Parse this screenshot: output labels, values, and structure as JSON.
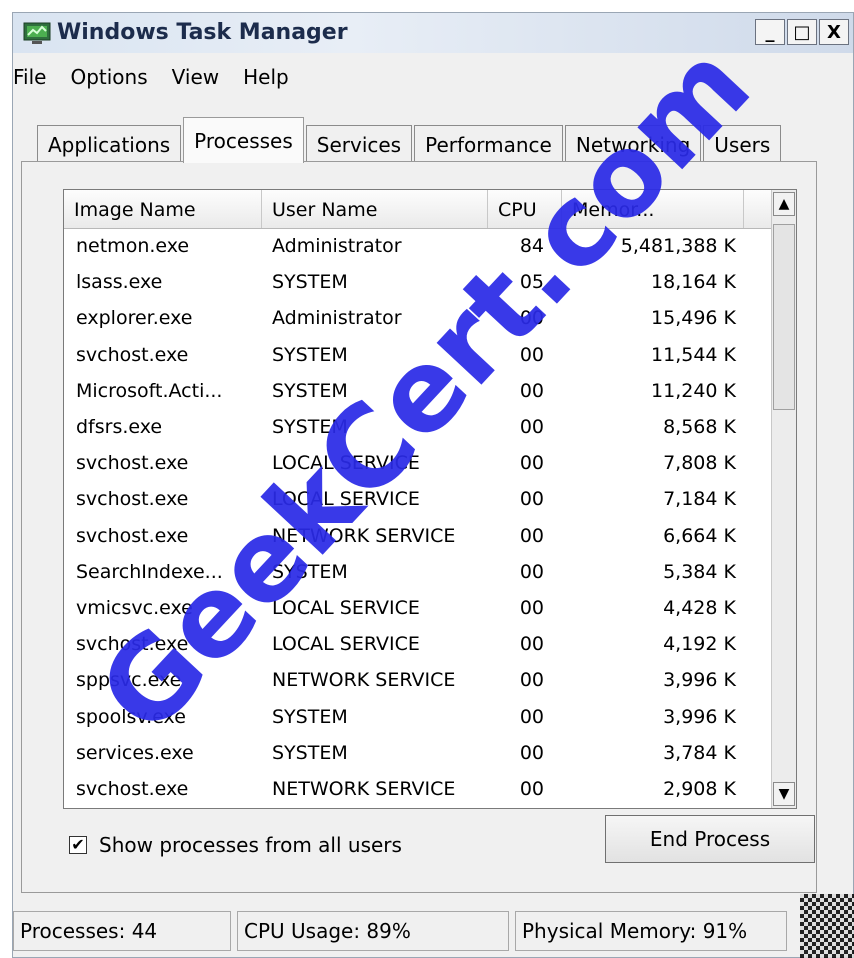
{
  "window": {
    "title": "Windows Task Manager",
    "controls": {
      "minimize": "_",
      "maximize": "□",
      "close": "X"
    }
  },
  "menu": [
    "File",
    "Options",
    "View",
    "Help"
  ],
  "tabs": [
    {
      "label": "Applications",
      "active": false
    },
    {
      "label": "Processes",
      "active": true
    },
    {
      "label": "Services",
      "active": false
    },
    {
      "label": "Performance",
      "active": false
    },
    {
      "label": "Networking",
      "active": false
    },
    {
      "label": "Users",
      "active": false
    }
  ],
  "table": {
    "headers": [
      "Image Name",
      "User Name",
      "CPU",
      "Memor..."
    ],
    "rows": [
      [
        "netmon.exe",
        "Administrator",
        "84",
        "5,481,388 K"
      ],
      [
        "lsass.exe",
        "SYSTEM",
        "05",
        "18,164 K"
      ],
      [
        "explorer.exe",
        "Administrator",
        "00",
        "15,496 K"
      ],
      [
        "svchost.exe",
        "SYSTEM",
        "00",
        "11,544 K"
      ],
      [
        "Microsoft.Acti...",
        "SYSTEM",
        "00",
        "11,240 K"
      ],
      [
        "dfsrs.exe",
        "SYSTEM",
        "00",
        "8,568 K"
      ],
      [
        "svchost.exe",
        "LOCAL SERVICE",
        "00",
        "7,808 K"
      ],
      [
        "svchost.exe",
        "LOCAL SERVICE",
        "00",
        "7,184 K"
      ],
      [
        "svchost.exe",
        "NETWORK SERVICE",
        "00",
        "6,664 K"
      ],
      [
        "SearchIndexe...",
        "SYSTEM",
        "00",
        "5,384 K"
      ],
      [
        "vmicsvc.exe",
        "LOCAL SERVICE",
        "00",
        "4,428 K"
      ],
      [
        "svchost.exe",
        "LOCAL SERVICE",
        "00",
        "4,192 K"
      ],
      [
        "sppsvc.exe",
        "NETWORK SERVICE",
        "00",
        "3,996 K"
      ],
      [
        "spoolsv.exe",
        "SYSTEM",
        "00",
        "3,996 K"
      ],
      [
        "services.exe",
        "SYSTEM",
        "00",
        "3,784 K"
      ],
      [
        "svchost.exe",
        "NETWORK SERVICE",
        "00",
        "2,908 K"
      ]
    ]
  },
  "show_all": {
    "label": "Show processes from all users",
    "checked": true,
    "mark": "✔"
  },
  "end_process": {
    "label": "End Process"
  },
  "status": {
    "processes": "Processes: 44",
    "cpu": "CPU Usage: 89%",
    "memory": "Physical Memory: 91%"
  },
  "watermark": {
    "text": "GeekCert.com",
    "color": "#2a2ae6"
  },
  "colors": {
    "title_text": "#1c2c4c",
    "panel": "#f0f0f0",
    "list_bg": "#ffffff"
  }
}
